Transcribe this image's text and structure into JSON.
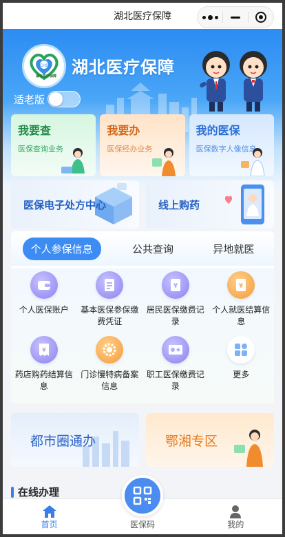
{
  "header": {
    "title": "湖北医疗保障"
  },
  "hero": {
    "title": "湖北医疗保障",
    "logo_text": "湖北医疗保障",
    "elder_mode_label": "适老版",
    "elder_mode_on": false
  },
  "quick_cards": [
    {
      "title": "我要查",
      "subtitle": "医保查询业务"
    },
    {
      "title": "我要办",
      "subtitle": "医保经办业务"
    },
    {
      "title": "我的医保",
      "subtitle": "医保数字人像信息"
    }
  ],
  "banners": [
    {
      "label": "医保电子处方中心"
    },
    {
      "label": "线上购药"
    }
  ],
  "info_tabs": {
    "active": "个人参保信息",
    "items": [
      "个人参保信息",
      "公共查询",
      "异地就医"
    ]
  },
  "services": [
    {
      "label": "个人医保账户",
      "icon": "wallet-icon"
    },
    {
      "label": "基本医保参保缴费凭证",
      "icon": "document-icon"
    },
    {
      "label": "居民医保缴费记录",
      "icon": "yuan-document-icon"
    },
    {
      "label": "个人就医结算信息",
      "icon": "yuan-settlement-icon"
    },
    {
      "label": "药店购药结算信息",
      "icon": "receipt-icon"
    },
    {
      "label": "门诊慢特病备案信息",
      "icon": "gear-flower-icon"
    },
    {
      "label": "职工医保缴费记录",
      "icon": "id-card-icon"
    },
    {
      "label": "更多",
      "icon": "grid-more-icon"
    }
  ],
  "bottom_banners": [
    {
      "label": "都市圈通办"
    },
    {
      "label": "鄂湘专区"
    }
  ],
  "section": {
    "title": "在线办理"
  },
  "tabbar": {
    "home": "首页",
    "qr": "医保码",
    "mine": "我的",
    "active": "首页"
  },
  "colors": {
    "accent": "#3d8cf4",
    "hero_top": "#2c8cf2",
    "tab_active": "#3a7ee8"
  }
}
